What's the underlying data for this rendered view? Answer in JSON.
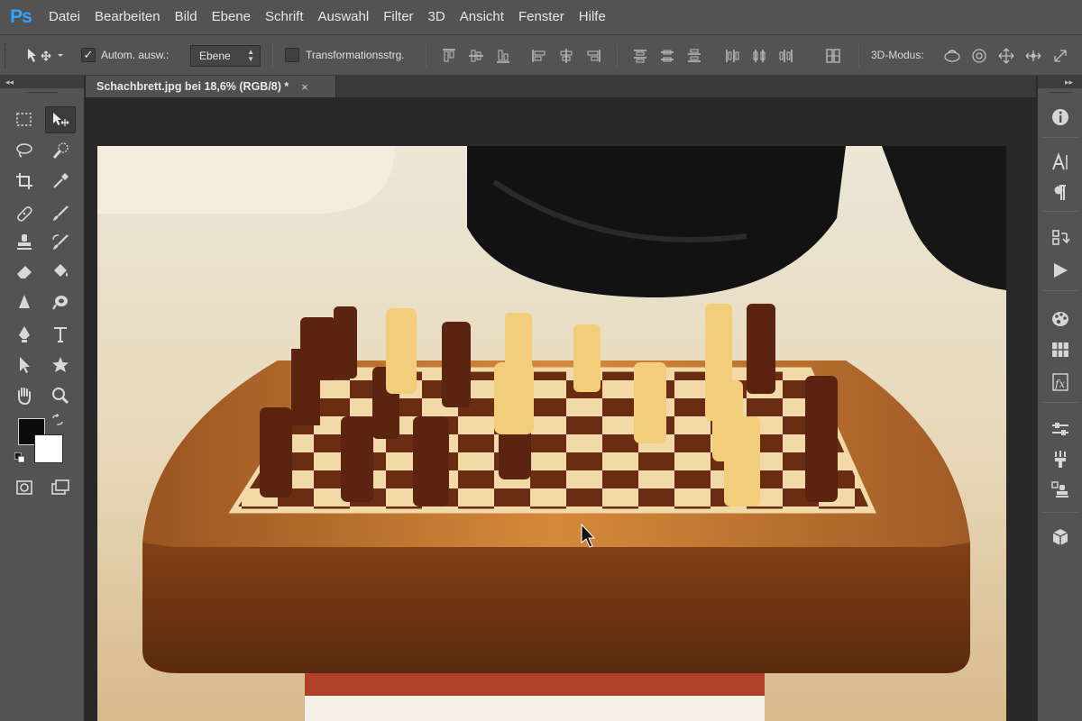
{
  "app": {
    "logo": "Ps",
    "brand_color": "#2fa3ff"
  },
  "menu": [
    "Datei",
    "Bearbeiten",
    "Bild",
    "Ebene",
    "Schrift",
    "Auswahl",
    "Filter",
    "3D",
    "Ansicht",
    "Fenster",
    "Hilfe"
  ],
  "options": {
    "auto_select_label": "Autom. ausw.:",
    "auto_select_checked": true,
    "auto_select_target": "Ebene",
    "transform_label": "Transformationsstrg.",
    "transform_checked": false,
    "mode3d_label": "3D-Modus:"
  },
  "document": {
    "tab_title": "Schachbrett.jpg bei 18,6% (RGB/8) *",
    "close_glyph": "×"
  },
  "tools": {
    "foreground_color": "#0b0b0b",
    "background_color": "#ffffff",
    "active_tool": "move-tool"
  },
  "right_panel": {
    "icons": [
      "info-icon",
      "character-icon",
      "paragraph-icon",
      "history-icon",
      "actions-icon",
      "color-icon",
      "swatches-icon",
      "styles-icon",
      "adjustments-icon",
      "brush-icon",
      "clone-source-icon",
      "3d-icon"
    ]
  }
}
